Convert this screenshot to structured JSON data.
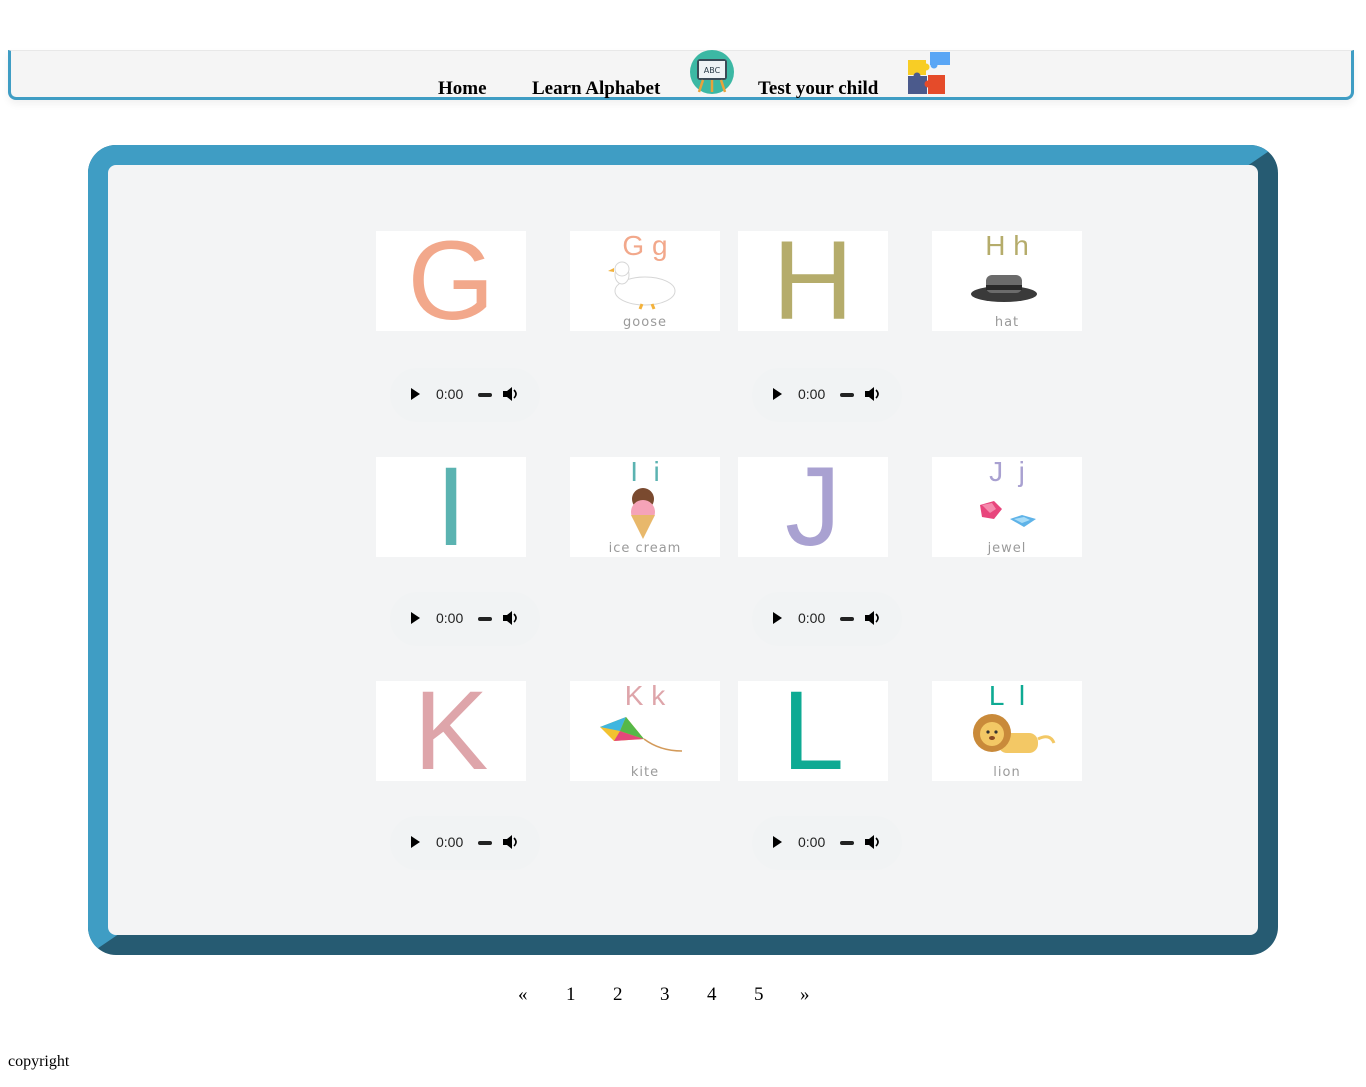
{
  "nav": {
    "home": "Home",
    "learn": "Learn Alphabet",
    "learn_icon_text": "ABC",
    "test": "Test your child"
  },
  "rows": [
    {
      "left": {
        "letter": "G",
        "pair": "G g",
        "word": "goose",
        "color": "#f2a88b"
      },
      "right": {
        "letter": "H",
        "pair": "H h",
        "word": "hat",
        "color": "#b5ac6b"
      }
    },
    {
      "left": {
        "letter": "I",
        "pair": "I  i",
        "word": "ice cream",
        "color": "#5bb3b1"
      },
      "right": {
        "letter": "J",
        "pair": "J  j",
        "word": "jewel",
        "color": "#a9a1d1"
      }
    },
    {
      "left": {
        "letter": "K",
        "pair": "K k",
        "word": "kite",
        "color": "#dea5aa"
      },
      "right": {
        "letter": "L",
        "pair": "L  l",
        "word": "lion",
        "color": "#0eaa93"
      }
    }
  ],
  "audio_time": "0:00",
  "pagination": [
    "«",
    "1",
    "2",
    "3",
    "4",
    "5",
    "»"
  ],
  "footer": {
    "copyright": "copyright"
  }
}
